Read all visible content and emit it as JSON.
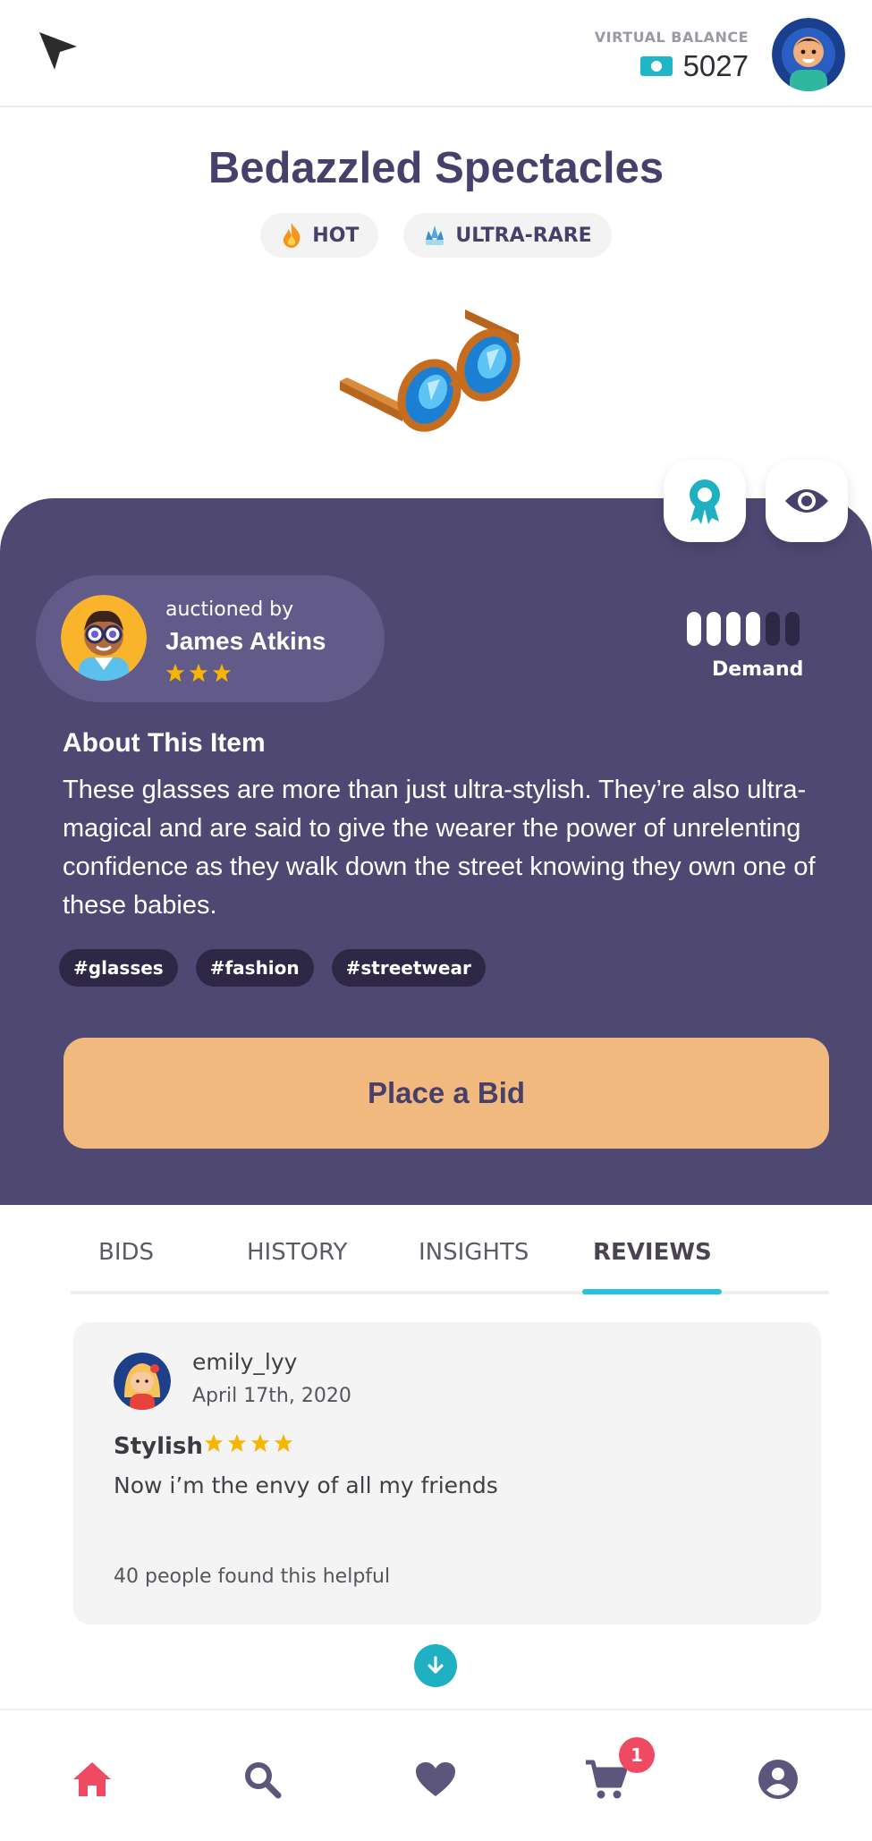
{
  "header": {
    "balance_label": "VIRTUAL BALANCE",
    "balance_value": "5027"
  },
  "item": {
    "title": "Bedazzled Spectacles",
    "badges": [
      {
        "label": "HOT",
        "icon": "flame-icon"
      },
      {
        "label": "ULTRA-RARE",
        "icon": "crystal-icon"
      }
    ]
  },
  "seller": {
    "sub_label": "auctioned by",
    "name": "James Atkins",
    "rating": 3
  },
  "demand": {
    "label": "Demand",
    "level": 4,
    "max": 6
  },
  "about": {
    "title": "About This Item",
    "text": "These glasses are more than just ultra-stylish. They’re also ultra-magical and are said to give the wearer the power of unrelenting confidence as they walk down the street knowing they own one of these babies.",
    "tags": [
      "#glasses",
      "#fashion",
      "#streetwear"
    ]
  },
  "actions": {
    "bid_label": "Place a Bid"
  },
  "tabs": [
    {
      "label": "BIDS",
      "active": false
    },
    {
      "label": "HISTORY",
      "active": false
    },
    {
      "label": "INSIGHTS",
      "active": false
    },
    {
      "label": "REVIEWS",
      "active": true
    }
  ],
  "review": {
    "username": "emily_lyy",
    "date": "April 17th, 2020",
    "title": "Stylish",
    "rating": 4,
    "body": "Now i’m the envy of all my friends",
    "helpful": "40 people found this helpful"
  },
  "bottom_nav": {
    "items": [
      "home-icon",
      "search-icon",
      "heart-icon",
      "cart-icon",
      "profile-icon"
    ],
    "cart_count": "1"
  },
  "colors": {
    "card": "#4e4873",
    "accent_teal": "#1fb0c2",
    "bid_button": "#f2b97e",
    "star": "#f7b500",
    "nav_active": "#f04a62"
  }
}
